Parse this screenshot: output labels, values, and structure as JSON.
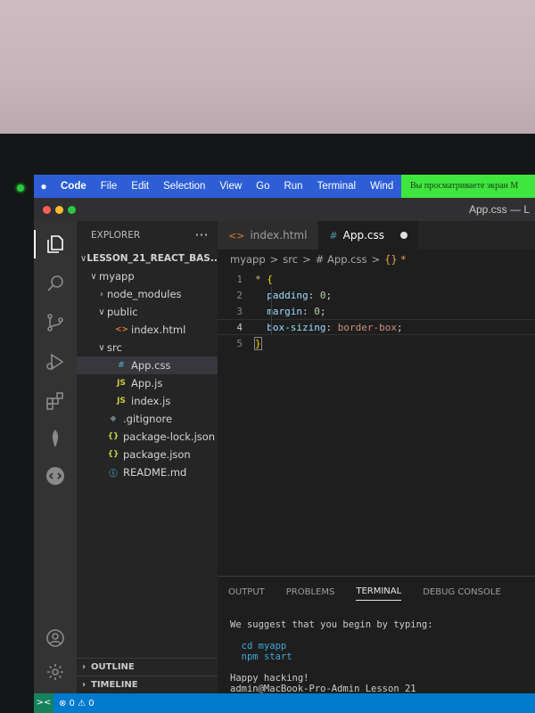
{
  "menubar": {
    "app": "Code",
    "items": [
      "File",
      "Edit",
      "Selection",
      "View",
      "Go",
      "Run",
      "Terminal",
      "Wind"
    ],
    "banner": "Вы просматриваете экран М"
  },
  "window": {
    "title": "App.css — L"
  },
  "sidebar": {
    "header": "EXPLORER",
    "more": "···",
    "tree": [
      {
        "label": "LESSON_21_REACT_BAS...",
        "chevron": "∨",
        "icon": "",
        "icon_color": "",
        "indent": 0,
        "root": true
      },
      {
        "label": "myapp",
        "chevron": "∨",
        "icon": "",
        "icon_color": "",
        "indent": 1
      },
      {
        "label": "node_modules",
        "chevron": "›",
        "icon": "",
        "icon_color": "",
        "indent": 2
      },
      {
        "label": "public",
        "chevron": "∨",
        "icon": "",
        "icon_color": "",
        "indent": 2
      },
      {
        "label": "index.html",
        "chevron": "",
        "icon": "<>",
        "icon_color": "#e37933",
        "indent": 3
      },
      {
        "label": "src",
        "chevron": "∨",
        "icon": "",
        "icon_color": "",
        "indent": 2
      },
      {
        "label": "App.css",
        "chevron": "",
        "icon": "#",
        "icon_color": "#519aba",
        "indent": 3,
        "selected": true
      },
      {
        "label": "App.js",
        "chevron": "",
        "icon": "JS",
        "icon_color": "#cbcb41",
        "indent": 3
      },
      {
        "label": "index.js",
        "chevron": "",
        "icon": "JS",
        "icon_color": "#cbcb41",
        "indent": 3
      },
      {
        "label": ".gitignore",
        "chevron": "",
        "icon": "◆",
        "icon_color": "#6d8086",
        "indent": 2
      },
      {
        "label": "package-lock.json",
        "chevron": "",
        "icon": "{}",
        "icon_color": "#cbcb41",
        "indent": 2
      },
      {
        "label": "package.json",
        "chevron": "",
        "icon": "{}",
        "icon_color": "#cbcb41",
        "indent": 2
      },
      {
        "label": "README.md",
        "chevron": "",
        "icon": "ⓘ",
        "icon_color": "#519aba",
        "indent": 2
      }
    ],
    "outline": "OUTLINE",
    "timeline": "TIMELINE"
  },
  "tabs": [
    {
      "label": "index.html",
      "icon": "<>",
      "icon_color": "#e37933",
      "active": false
    },
    {
      "label": "App.css",
      "icon": "#",
      "icon_color": "#519aba",
      "active": true,
      "modified": true
    }
  ],
  "breadcrumbs": [
    "myapp",
    ">",
    "src",
    ">",
    "# App.css",
    ">",
    "{} *"
  ],
  "code": {
    "line_numbers": [
      "1",
      "2",
      "3",
      "4",
      "5"
    ],
    "selector": "*",
    "open_brace": "{",
    "close_brace": "}",
    "declarations": [
      {
        "prop": "padding",
        "value": "0",
        "value_type": "num"
      },
      {
        "prop": "margin",
        "value": "0",
        "value_type": "num"
      },
      {
        "prop": "box-sizing",
        "value": "border-box",
        "value_type": "val"
      }
    ]
  },
  "panel": {
    "tabs": [
      "OUTPUT",
      "PROBLEMS",
      "TERMINAL",
      "DEBUG CONSOLE"
    ],
    "active_tab": "TERMINAL",
    "terminal": {
      "line1": "We suggest that you begin by typing:",
      "cmd1": "cd myapp",
      "cmd2": "npm start",
      "line4": "Happy hacking!",
      "prompt": "admin@MacBook-Pro-Admin Lesson_21"
    }
  },
  "status": {
    "problems": "⊗ 0 ⚠ 0"
  }
}
